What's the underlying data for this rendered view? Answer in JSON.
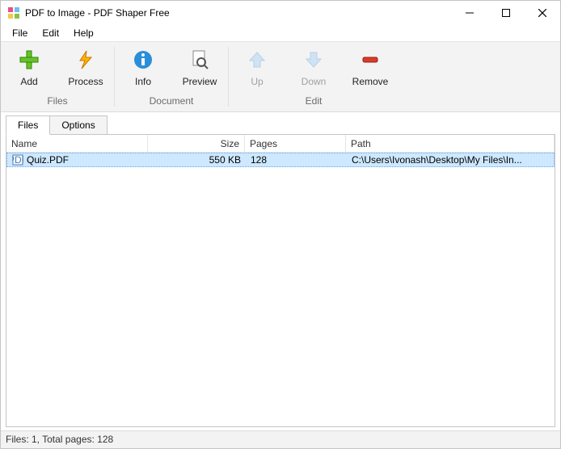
{
  "window": {
    "title": "PDF to Image - PDF Shaper Free"
  },
  "menu": {
    "file": "File",
    "edit": "Edit",
    "help": "Help"
  },
  "toolbar": {
    "add": "Add",
    "process": "Process",
    "info": "Info",
    "preview": "Preview",
    "up": "Up",
    "down": "Down",
    "remove": "Remove",
    "group_files": "Files",
    "group_document": "Document",
    "group_edit": "Edit"
  },
  "tabs": {
    "files": "Files",
    "options": "Options"
  },
  "columns": {
    "name": "Name",
    "size": "Size",
    "pages": "Pages",
    "path": "Path"
  },
  "rows": [
    {
      "name": "Quiz.PDF",
      "size": "550 KB",
      "pages": "128",
      "path": "C:\\Users\\Ivonash\\Desktop\\My Files\\In..."
    }
  ],
  "status": "Files: 1, Total pages: 128"
}
